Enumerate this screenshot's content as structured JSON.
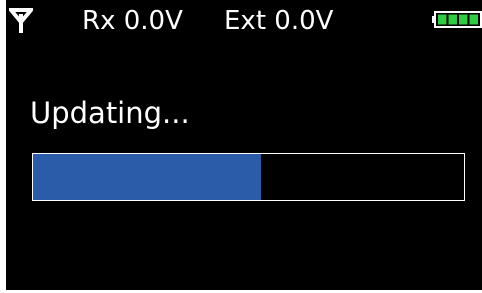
{
  "status_bar": {
    "signal_icon": "antenna-icon",
    "rx_label": "Rx 0.0V",
    "ext_label": "Ext 0.0V",
    "battery_icon": "battery-icon",
    "battery_segments_filled": 4,
    "battery_color": "#2ecc40"
  },
  "main": {
    "message": "Updating...",
    "progress_fraction": 0.53,
    "progress_color": "#2a5caa"
  }
}
